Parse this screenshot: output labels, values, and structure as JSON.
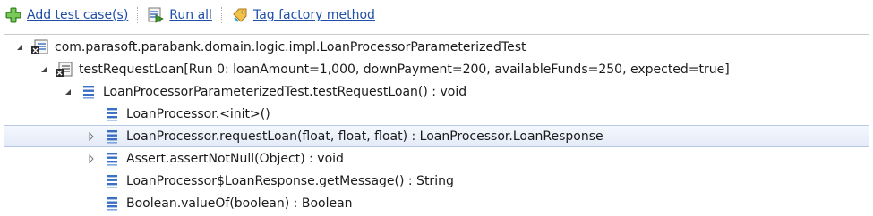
{
  "toolbar": {
    "add_test_case_label": "Add test case(s)",
    "run_all_label": "Run all",
    "tag_factory_method_label": "Tag factory method"
  },
  "tree": {
    "nodes": [
      {
        "label": "com.parasoft.parabank.domain.logic.impl.LoanProcessorParameterizedTest",
        "icon": "test-class-icon",
        "expander": "expanded"
      },
      {
        "label": "testRequestLoan[Run 0: loanAmount=1,000, downPayment=200, availableFunds=250, expected=true]",
        "icon": "test-case-icon",
        "expander": "expanded"
      },
      {
        "label": "LoanProcessorParameterizedTest.testRequestLoan() : void",
        "icon": "method-call-icon",
        "expander": "expanded"
      },
      {
        "label": "LoanProcessor.<init>()",
        "icon": "method-call-icon",
        "expander": "none"
      },
      {
        "label": "LoanProcessor.requestLoan(float, float, float) : LoanProcessor.LoanResponse",
        "icon": "method-call-icon",
        "expander": "collapsed",
        "selected": true
      },
      {
        "label": "Assert.assertNotNull(Object) : void",
        "icon": "method-call-icon",
        "expander": "collapsed"
      },
      {
        "label": "LoanProcessor$LoanResponse.getMessage() : String",
        "icon": "method-call-icon",
        "expander": "none"
      },
      {
        "label": "Boolean.valueOf(boolean) : Boolean",
        "icon": "method-call-icon",
        "expander": "none"
      }
    ]
  },
  "colors": {
    "link": "#1f4fa8",
    "selection": "#e4ebf8",
    "method_icon": "#3a6fc4"
  }
}
